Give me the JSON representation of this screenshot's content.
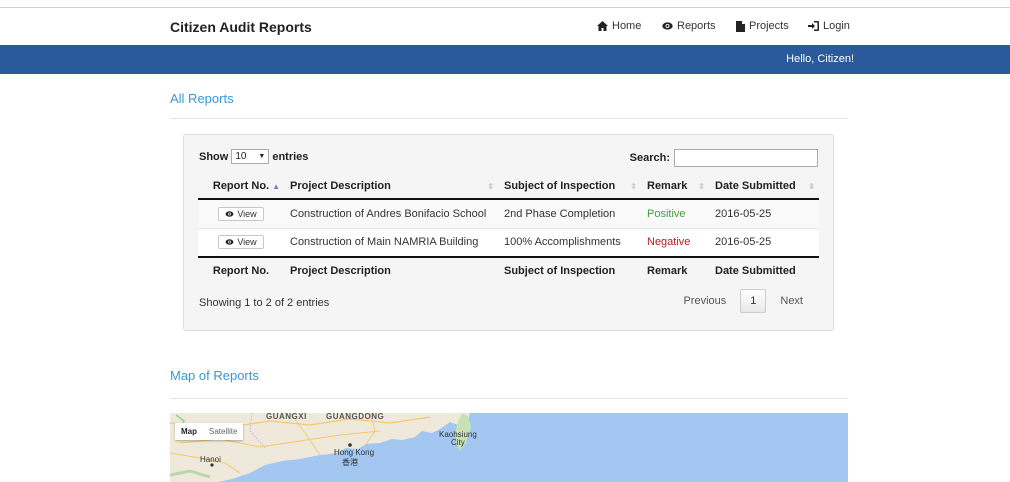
{
  "app": {
    "title": "Citizen Audit Reports"
  },
  "nav": [
    {
      "label": "Home",
      "icon": "home-icon"
    },
    {
      "label": "Reports",
      "icon": "eye-icon"
    },
    {
      "label": "Projects",
      "icon": "file-icon"
    },
    {
      "label": "Login",
      "icon": "login-icon"
    }
  ],
  "greeting": "Hello, Citizen!",
  "reports": {
    "heading": "All Reports",
    "length": {
      "prefix": "Show",
      "value": "10",
      "suffix": "entries"
    },
    "search_label": "Search:",
    "search_value": "",
    "columns": [
      "Report No.",
      "Project Description",
      "Subject of Inspection",
      "Remark",
      "Date Submitted"
    ],
    "rows": [
      {
        "button": "View",
        "project": "Construction of Andres Bonifacio School",
        "subject": "2nd Phase Completion",
        "remark": "Positive",
        "date": "2016-05-25"
      },
      {
        "button": "View",
        "project": "Construction of Main NAMRIA Building",
        "subject": "100% Accomplishments",
        "remark": "Negative",
        "date": "2016-05-25"
      }
    ],
    "info": "Showing 1 to 2 of 2 entries",
    "pager": {
      "previous": "Previous",
      "current": "1",
      "next": "Next"
    }
  },
  "map": {
    "heading": "Map of Reports",
    "type_map": "Map",
    "type_satellite": "Satellite",
    "labels": {
      "guangxi": "GUANGXI",
      "guangdong": "GUANGDONG",
      "hanoi": "Hanoi",
      "hongkong": "Hong Kong",
      "hongkong_cn": "香港",
      "kaohsiung": "Kaohsiung",
      "city": "City"
    }
  },
  "colors": {
    "brand_bar": "#2a5a9b",
    "accent": "#3a97d4",
    "positive": "#3aa33a",
    "negative": "#b02020"
  }
}
